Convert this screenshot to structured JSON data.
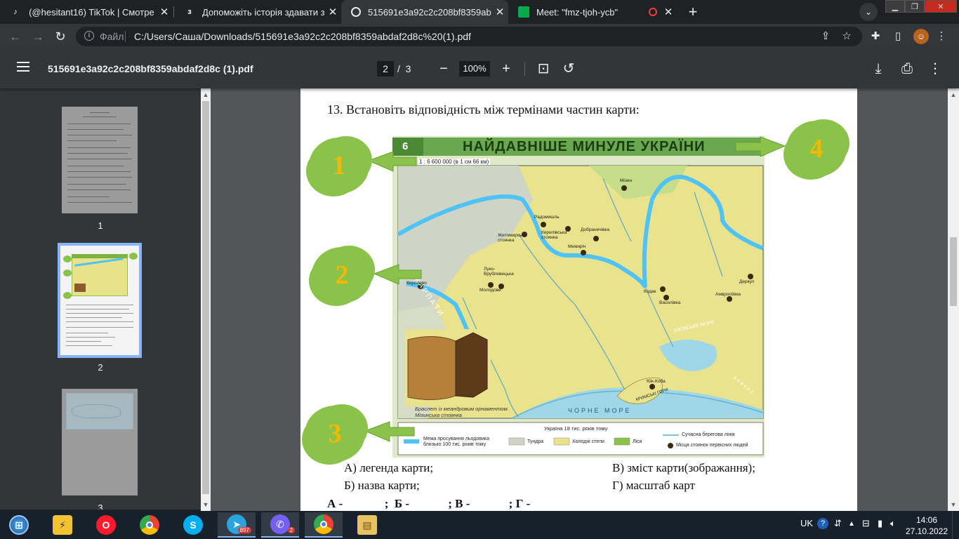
{
  "tabs": [
    {
      "title": " (@hesitant16) TikTok | Смотре",
      "icon": "tiktok-icon"
    },
    {
      "title": "Допоможіть історія здавати за",
      "icon": "znanija-icon"
    },
    {
      "title": "515691e3a92c2c208bf8359abdaf",
      "icon": "chrome-file-icon"
    },
    {
      "title": "Meet: \"fmz-tjoh-ycb\"",
      "icon": "meet-icon"
    }
  ],
  "address": {
    "scheme": "Файл",
    "url": "C:/Users/Саша/Downloads/515691e3a92c2c208bf8359abdaf2d8c%20(1).pdf"
  },
  "pdf": {
    "filename": "515691e3a92c2c208bf8359abdaf2d8c (1).pdf",
    "current_page": "2",
    "page_sep": "/",
    "total_pages": "3",
    "zoom": "100%"
  },
  "thumbnails": [
    {
      "label": "1"
    },
    {
      "label": "2"
    },
    {
      "label": "3"
    }
  ],
  "document": {
    "question": "13. Встановіть відповідність між термінами частин карти:",
    "map": {
      "banner": "НАЙДАВНІШЕ МИНУЛЕ УКРАЇНИ",
      "page_no": "6",
      "scale": "1 : 6 600 000 (в 1 см 66 км)",
      "clouds": [
        "1",
        "2",
        "3",
        "4"
      ],
      "sea_black": "ЧОРНЕ   МОРЕ",
      "sea_azov": "АЗОВСЬКЕ МОРЕ",
      "carpathians": "К А Р П А Т И",
      "bracelet": "Браслет із меандровим орнаментом. Мізинська стоянка",
      "legend_title": "Україна 18 тис. років тому",
      "legend_items": [
        "Межа просування льодовика близько 100 тис. років тому",
        "Тундра",
        "Холодні степи",
        "Ліси",
        "Сучасна берегова лінія",
        "Місця стоянок первісних людей"
      ],
      "sites": [
        "Мізин",
        "Радомишль",
        "Кирилівська стоянка",
        "Добраничівка",
        "Житомирська стоянка",
        "Межиріч",
        "Луко-Врублевецька",
        "Молодове",
        "Королево",
        "Кодак",
        "Василівка",
        "Амвросіївка",
        "Деркул",
        "Кіїк-Коба",
        "КРИМСЬКІ ГОРИ",
        "КАВКАЗ"
      ]
    },
    "options": {
      "a": "А) легенда карти;",
      "b": "Б)  назва карти;",
      "v": "В) зміст карти(зображання);",
      "g": "Г)  масштаб карт"
    },
    "answer_line": "А -              ;  Б -             ; В -             ; Г -"
  },
  "taskbar": {
    "apps": [
      "start-orb",
      "hamster-icon",
      "opera-icon",
      "chrome-icon",
      "skype-icon",
      "telegram-icon",
      "viber-icon",
      "chrome-active-icon",
      "file-explorer-icon"
    ],
    "telegram_badge": "897",
    "viber_badge": "2",
    "lang": "UK",
    "time": "14:06",
    "date": "27.10.2022"
  }
}
